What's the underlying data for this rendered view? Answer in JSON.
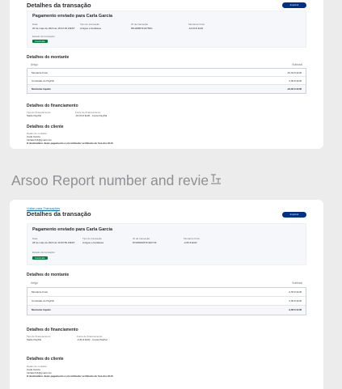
{
  "caption": {
    "text": "Arsoo   Report number and revie"
  },
  "top": {
    "title": "Detalhes da transação",
    "print_label": "Imprimir",
    "payment_title": "Pagamento enviado para Carla Garcia",
    "meta": [
      {
        "label": "Data",
        "value": "20 de maio de 2024 às 18:22:39 WEST"
      },
      {
        "label": "Tipo de transação",
        "value": "Amigos e familiares"
      },
      {
        "label": "ID da transação",
        "value": "8FH48867F44756G"
      },
      {
        "label": "Montante bruto",
        "value": "-16,64 € EUR"
      }
    ],
    "status_label": "Estado da transação",
    "status": "Concluída",
    "amount_section": "Detalhes do montante",
    "amount_header": {
      "item": "Artigo",
      "subtotal": "Subtotal"
    },
    "amount_rows": [
      {
        "label": "Montante bruto",
        "value": "-16,64 € EUR"
      },
      {
        "label": "Comissão do PayPal",
        "value": "0,00 € EUR"
      },
      {
        "label": "Montante líquido",
        "value": "-16,64 € EUR"
      }
    ],
    "funding_section": "Detalhes do financiamento",
    "funding": [
      {
        "label": "Tipo de financiamento",
        "value": "Saldo PayPal"
      },
      {
        "label": "Fonte de financiamento",
        "value": "-16,64 € EUR - Conta PayPal"
      }
    ],
    "client_section": "Detalhes do cliente",
    "client": {
      "label": "Dados de contacto",
      "name": "Carla Garcia",
      "email": "carlaferr16@gmail.com",
      "note": "O destinatário deste pagamento é um utilizador verificado de fora dos EUA"
    }
  },
  "bottom": {
    "back_link": "Voltar para Transações",
    "title": "Detalhes da transação",
    "print_label": "Imprimir",
    "payment_title": "Pagamento enviado para Carla Garcia",
    "meta": [
      {
        "label": "Data",
        "value": "28 de maio de 2024 às 16:05:59 WEST"
      },
      {
        "label": "Tipo de transação",
        "value": "Amigos e familiares"
      },
      {
        "label": "ID da transação",
        "value": "8Y0650025TF4407X6"
      },
      {
        "label": "Montante bruto",
        "value": "-2,66 € EUR"
      }
    ],
    "status_label": "Estado da transação",
    "status": "Concluída",
    "amount_section": "Detalhes do montante",
    "amount_header": {
      "item": "Artigo",
      "subtotal": "Subtotal"
    },
    "amount_rows": [
      {
        "label": "Montante bruto",
        "value": "-2,66 € EUR"
      },
      {
        "label": "Comissão do PayPal",
        "value": "0,00 € EUR"
      },
      {
        "label": "Montante líquido",
        "value": "-2,66 € EUR"
      }
    ],
    "funding_section": "Detalhes do financiamento",
    "funding": [
      {
        "label": "Tipo de financiamento",
        "value": "Saldo PayPal"
      },
      {
        "label": "Fonte de financiamento",
        "value": "-2,66 € EUR - Conta PayPal"
      }
    ],
    "client_section": "Detalhes do cliente",
    "client": {
      "label": "Dados de contacto",
      "name": "Carla Garcia",
      "email": "carlaferr16@gmail.com",
      "note": "O destinatário deste pagamento é um utilizador verificado de fora dos EUA"
    }
  }
}
